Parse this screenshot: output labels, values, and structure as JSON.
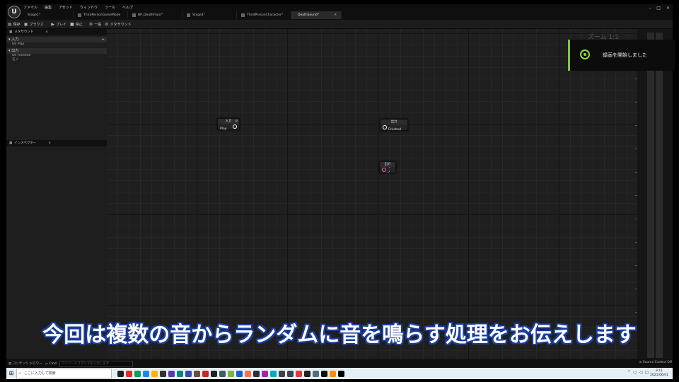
{
  "menu": [
    "ファイル",
    "編集",
    "アセット",
    "ウィンドウ",
    "ツール",
    "ヘルプ"
  ],
  "tabs": [
    "Stage1*",
    "ThirdPersonGameMode",
    "BP_DeathFloor*",
    "Stage1*",
    "ThirdPersonCharacter*",
    "DeathSound*"
  ],
  "active_tab_close": "×",
  "window_controls": [
    "–",
    "□",
    "×"
  ],
  "toolbar": {
    "save": "保存",
    "browse": "ブラウズ",
    "play": "プレイ",
    "stop": "停止",
    "general": "一般",
    "metasound": "メタサウンド"
  },
  "left_panel": {
    "tab": "メタサウンド",
    "inputs_header": "入力",
    "inputs": [
      "On Play"
    ],
    "outputs_header": "出力",
    "outputs": [
      "On Finished",
      "モノ"
    ],
    "add": "+"
  },
  "inspector_tab": "インスペクター",
  "graph": {
    "zoom": "ズーム 1:1",
    "nodes": [
      {
        "title": "入力",
        "pin": "On Play"
      },
      {
        "title": "出力",
        "pin": "On Finished"
      },
      {
        "title": "出力",
        "pin": "モノ"
      }
    ]
  },
  "toast": {
    "message": "録画を開始しました"
  },
  "status": {
    "content_drawer": "コンテンツ ドロワー",
    "cmd": "Cmd",
    "cmd_placeholder": "コンソールコマンドを入力します",
    "source_control": "Source Control Off"
  },
  "caption": "今回は複数の音からランダムに音を鳴らす処理をお伝えします",
  "taskbar": {
    "search_placeholder": "ここに入力して検索",
    "time": "9:11",
    "date": "2021/06/01",
    "app_colors": [
      "#222222",
      "#d93025",
      "#0f9d58",
      "#1e88e5",
      "#ffb300",
      "#333333",
      "#5e35b1",
      "#00897b",
      "#3949ab",
      "#6d4c41",
      "#c62828",
      "#222222",
      "#455a64",
      "#7cb342",
      "#1565c0",
      "#ff7043",
      "#263238",
      "#9c27b0",
      "#00acc1",
      "#424242",
      "#37474f",
      "#e53935",
      "#212121",
      "#546e7a",
      "#111111",
      "#fb8c00",
      "#000000"
    ]
  }
}
